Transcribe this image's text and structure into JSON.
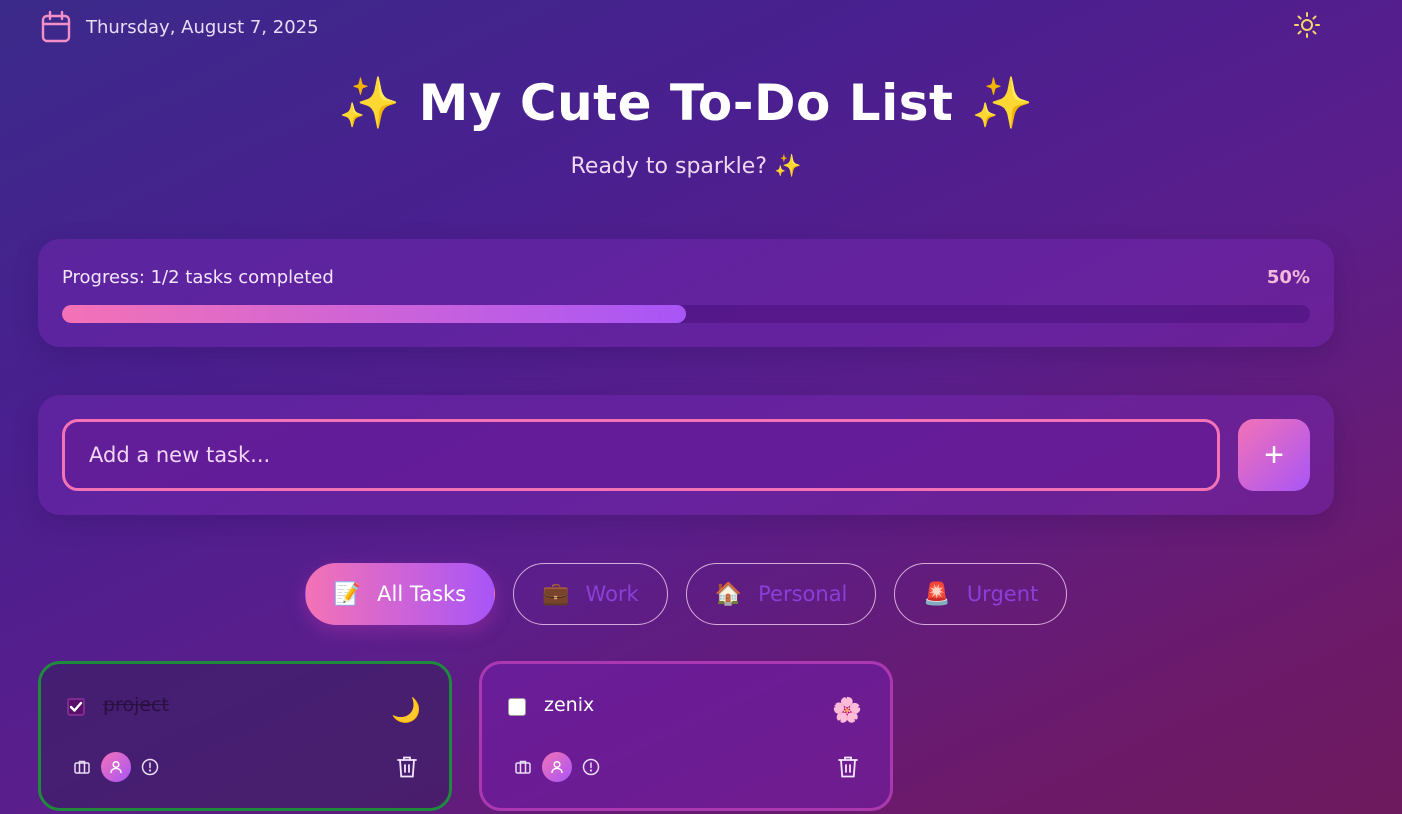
{
  "header": {
    "date": "Thursday, August 7, 2025",
    "title": "✨ My Cute To-Do List ✨",
    "subtitle": "Ready to sparkle? ✨"
  },
  "progress": {
    "label": "Progress: 1/2 tasks completed",
    "percent_text": "50%",
    "fraction": 0.5
  },
  "add_task": {
    "placeholder": "Add a new task...",
    "button_label": "+"
  },
  "filters": [
    {
      "emoji": "📝",
      "label": "All Tasks",
      "active": true
    },
    {
      "emoji": "💼",
      "label": "Work",
      "active": false
    },
    {
      "emoji": "🏠",
      "label": "Personal",
      "active": false
    },
    {
      "emoji": "🚨",
      "label": "Urgent",
      "active": false
    }
  ],
  "tasks": [
    {
      "text": "project",
      "completed": true,
      "mood_emoji": "🌙",
      "border_color": "#1e8a3c"
    },
    {
      "text": "zenix",
      "completed": false,
      "mood_emoji": "🌸",
      "border_color": "#c846be"
    }
  ],
  "icons": {
    "date": "calendar-icon",
    "theme": "sun-icon",
    "category": "briefcase-icon",
    "assignee": "user-icon",
    "priority": "alert-circle-icon",
    "delete": "trash-icon"
  },
  "colors": {
    "accent_pink": "#f472b6",
    "accent_purple": "#a855f7",
    "completed_border": "#1e8a3c",
    "sun": "#f6d36b"
  }
}
